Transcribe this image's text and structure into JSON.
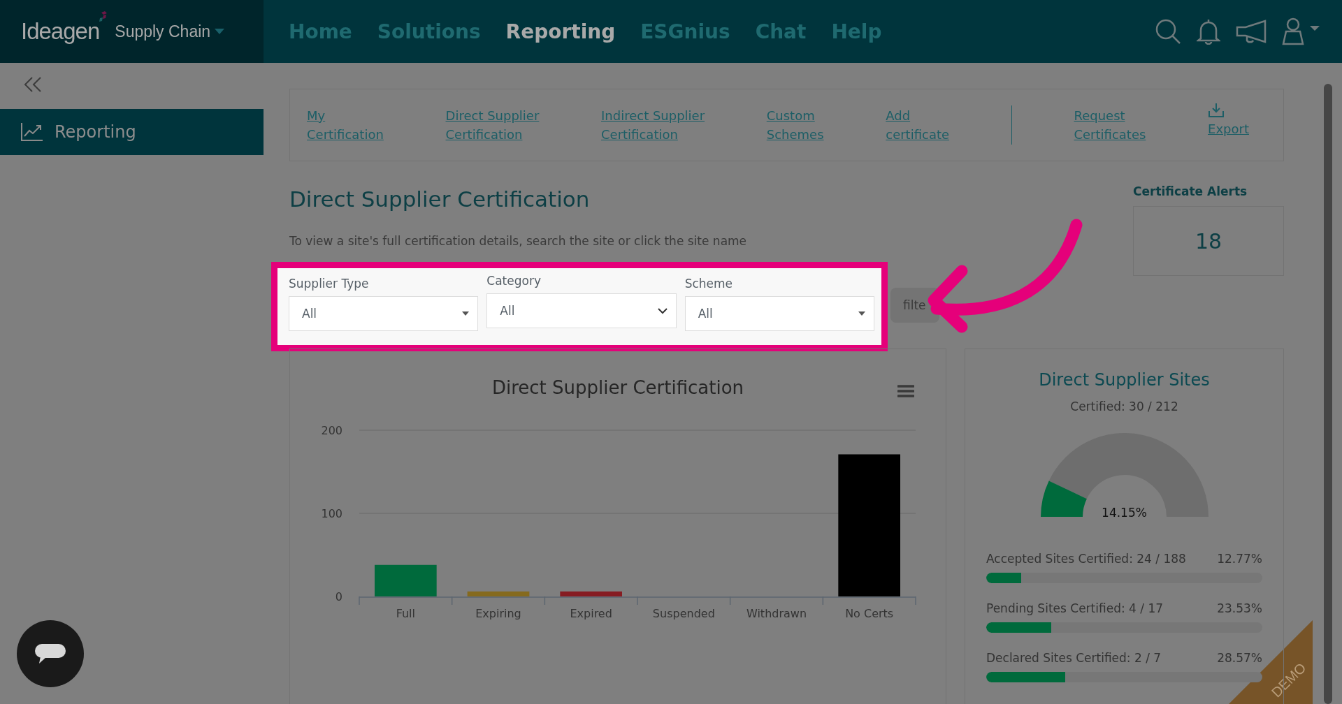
{
  "header": {
    "brand": "Ideagen",
    "product": "Supply Chain",
    "nav": [
      {
        "label": "Home",
        "selected": false
      },
      {
        "label": "Solutions",
        "selected": false
      },
      {
        "label": "Reporting",
        "selected": true
      },
      {
        "label": "ESGnius",
        "selected": false
      },
      {
        "label": "Chat",
        "selected": false
      },
      {
        "label": "Help",
        "selected": false
      }
    ]
  },
  "sidebar": {
    "items": [
      {
        "label": "Reporting",
        "selected": true
      }
    ]
  },
  "links": [
    {
      "kind": "text",
      "lines": [
        "My",
        "Certification"
      ],
      "divider_before": false
    },
    {
      "kind": "text",
      "lines": [
        "Direct Supplier",
        "Certification"
      ],
      "divider_before": false
    },
    {
      "kind": "text",
      "lines": [
        "Indirect Supplier",
        "Certification"
      ],
      "divider_before": false
    },
    {
      "kind": "text",
      "lines": [
        "Custom",
        "Schemes"
      ],
      "divider_before": false
    },
    {
      "kind": "text",
      "lines": [
        "Add",
        "certificate"
      ],
      "divider_before": false
    },
    {
      "kind": "text",
      "lines": [
        "Request",
        "Certificates"
      ],
      "divider_before": true
    },
    {
      "kind": "download",
      "lines": [
        "Export"
      ],
      "divider_before": false
    }
  ],
  "page_title": "Direct Supplier Certification",
  "description": "To view a site's full certification details, search the site or click the site name",
  "filters": [
    {
      "label": "Supplier Type",
      "value": "All",
      "kind": "caret"
    },
    {
      "label": "Category",
      "value": "All",
      "kind": "chevron"
    },
    {
      "label": "Scheme",
      "value": "All",
      "kind": "caret"
    }
  ],
  "filter_button": "filte",
  "alerts": {
    "title": "Certificate Alerts",
    "count": "18"
  },
  "chart_card": {
    "chart_data": {
      "type": "bar",
      "title": "Direct Supplier Certification",
      "categories": [
        "Full",
        "Expiring",
        "Expired",
        "Suspended",
        "Withdrawn",
        "No Certs"
      ],
      "series": [
        {
          "color": "#006a3c",
          "values": [
            38,
            null,
            null,
            null,
            null,
            null
          ]
        },
        {
          "color": "#856a1e",
          "values": [
            null,
            6,
            null,
            null,
            null,
            null
          ]
        },
        {
          "color": "#861c22",
          "values": [
            null,
            null,
            6,
            null,
            null,
            null
          ]
        },
        {
          "color": "#000000",
          "values": [
            null,
            null,
            null,
            0,
            0,
            171
          ]
        }
      ],
      "ylim": [
        0,
        200
      ],
      "yticks": [
        0,
        100,
        200
      ]
    }
  },
  "sites_card": {
    "title": "Direct Supplier Sites",
    "subtitle": "Certified: 30 / 212",
    "gauge": {
      "level": 0.1415,
      "reading": "14.15%"
    },
    "rows": [
      {
        "label": "Accepted Sites Certified: 24 / 188",
        "percent": "12.77%",
        "level": 0.1277
      },
      {
        "label": "Pending Sites Certified: 4 / 17",
        "percent": "23.53%",
        "level": 0.2353
      },
      {
        "label": "Declared Sites Certified: 2 / 7",
        "percent": "28.57%",
        "level": 0.2857
      }
    ]
  },
  "demo_ribbon": "DEMO"
}
